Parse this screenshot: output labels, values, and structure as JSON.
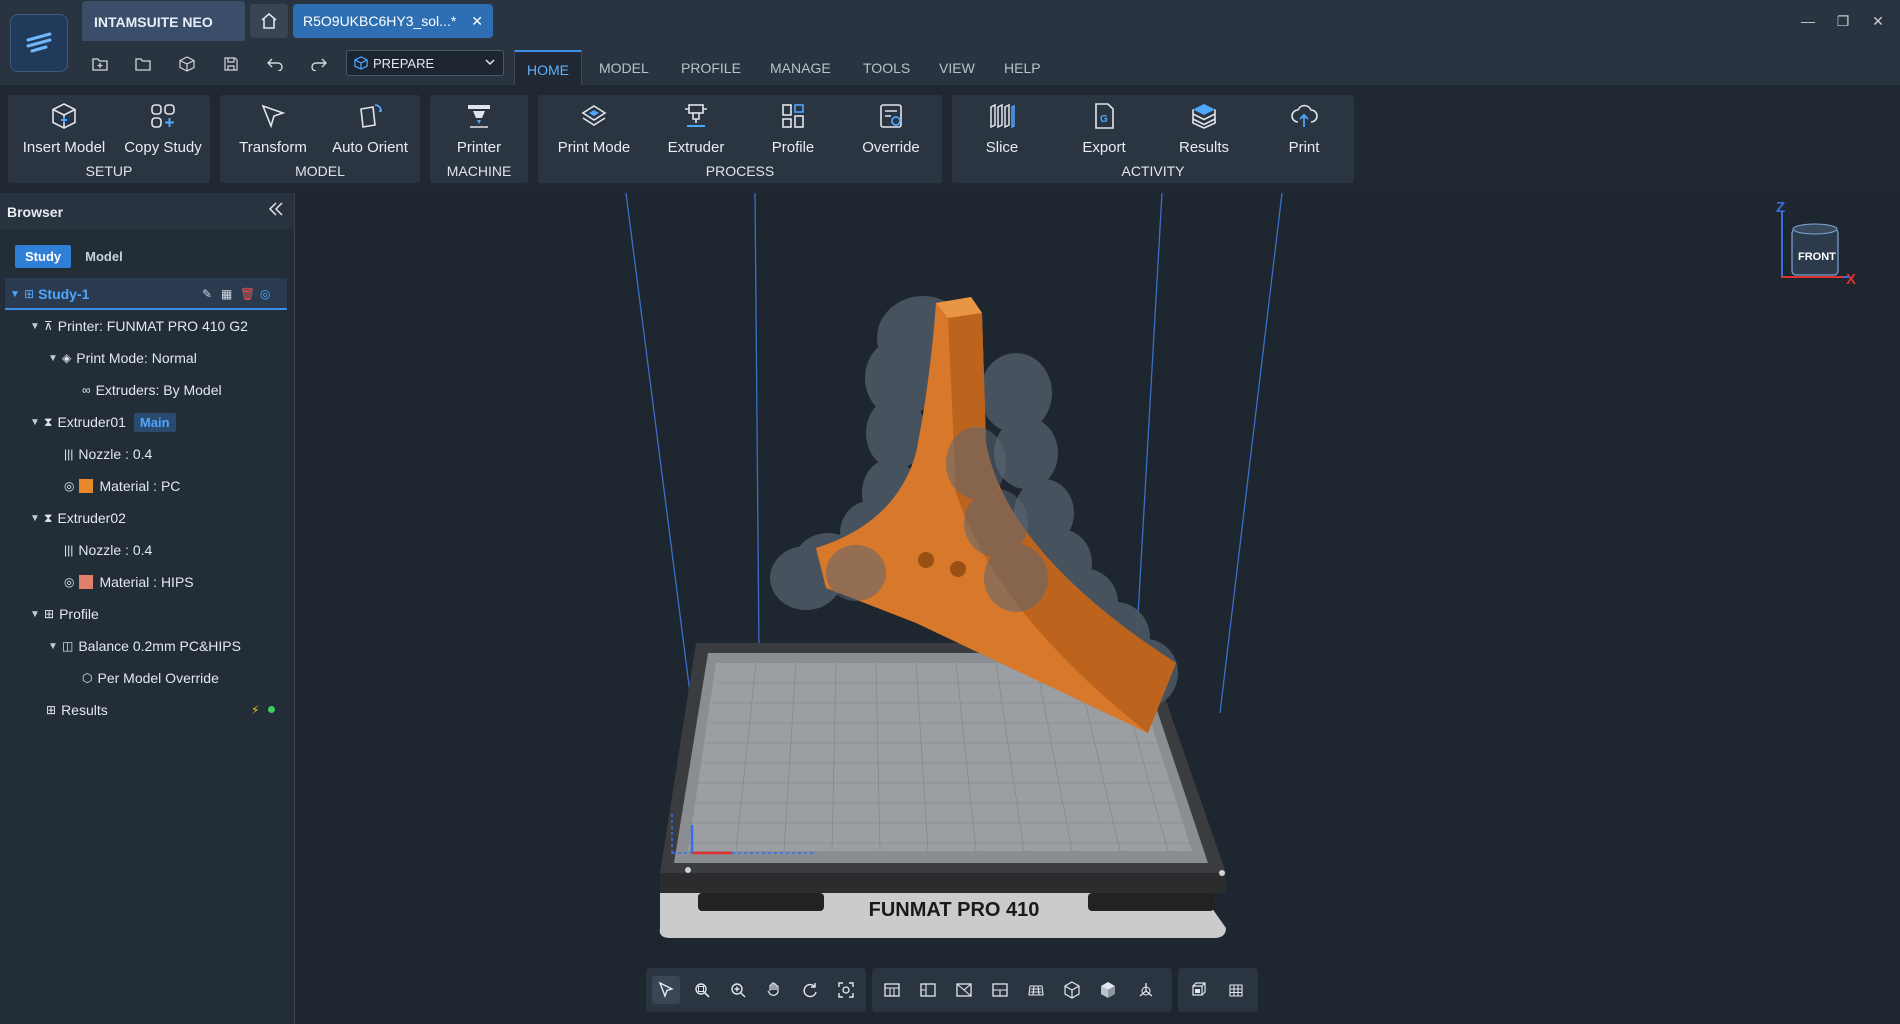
{
  "app": {
    "name": "INTAMSUITE NEO",
    "document_tab": "R5O9UKBC6HY3_sol...*",
    "mode": "PREPARE",
    "colors": {
      "accent": "#3d8ee8",
      "bg": "#1f2833",
      "orange_model": "#d7782a"
    }
  },
  "menu": [
    "HOME",
    "MODEL",
    "PROFILE",
    "MANAGE",
    "TOOLS",
    "VIEW",
    "HELP"
  ],
  "ribbon": {
    "setup": {
      "label": "SETUP",
      "insert": "Insert Model",
      "copy": "Copy Study"
    },
    "model": {
      "label": "MODEL",
      "transform": "Transform",
      "auto_orient": "Auto Orient"
    },
    "machine": {
      "label": "MACHINE",
      "printer": "Printer"
    },
    "process": {
      "label": "PROCESS",
      "print_mode": "Print Mode",
      "extruder": "Extruder",
      "profile": "Profile",
      "override": "Override"
    },
    "activity": {
      "label": "ACTIVITY",
      "slice": "Slice",
      "export": "Export",
      "results": "Results",
      "print": "Print"
    }
  },
  "browser": {
    "title": "Browser",
    "tabs": [
      "Study",
      "Model"
    ],
    "tree": {
      "study": "Study-1",
      "printer": "Printer: FUNMAT PRO 410 G2",
      "print_mode": "Print Mode: Normal",
      "extruders": "Extruders: By Model",
      "extruder1": "Extruder01",
      "main_badge": "Main",
      "nozzle1": "Nozzle : 0.4",
      "material1": "Material : PC",
      "extruder2": "Extruder02",
      "nozzle2": "Nozzle : 0.4",
      "material2": "Material : HIPS",
      "profile": "Profile",
      "balance": "Balance 0.2mm PC&HIPS",
      "override": "Per Model Override",
      "results": "Results"
    },
    "material_colors": {
      "pc": "#e8882a",
      "hips": "#e0806a"
    }
  },
  "viewport": {
    "printer_label": "FUNMAT PRO 410",
    "view_cube": "FRONT",
    "axis_z": "Z",
    "axis_x": "X"
  }
}
